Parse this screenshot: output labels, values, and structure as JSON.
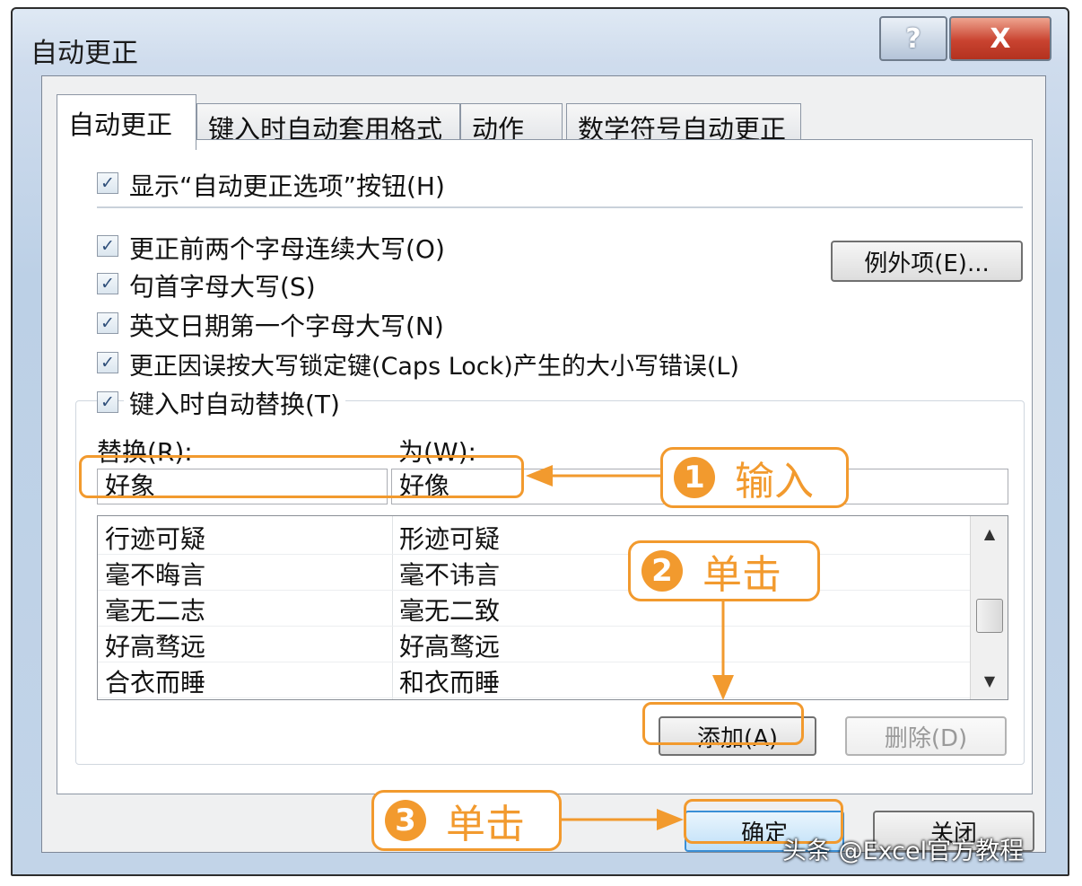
{
  "window": {
    "title": "自动更正",
    "help_label": "?",
    "close_label": "X"
  },
  "tabs": [
    {
      "label": "自动更正"
    },
    {
      "label": "键入时自动套用格式"
    },
    {
      "label": "动作"
    },
    {
      "label": "数学符号自动更正"
    }
  ],
  "options": {
    "show_buttons": "显示“自动更正选项”按钮(H)",
    "two_initials": "更正前两个字母连续大写(O)",
    "sentence_cap": "句首字母大写(S)",
    "day_names": "英文日期第一个字母大写(N)",
    "caps_lock": "更正因误按大写锁定键(Caps Lock)产生的大小写错误(L)",
    "replace_as_type": "键入时自动替换(T)",
    "check_mark": "✓"
  },
  "exceptions_button": "例外项(E)...",
  "replace": {
    "replace_label": "替换(R):",
    "with_label": "为(W):",
    "replace_value": "好象",
    "with_value": "好像"
  },
  "list": {
    "rows": [
      {
        "from": "行迹可疑",
        "to": "形迹可疑"
      },
      {
        "from": "毫不晦言",
        "to": "毫不讳言"
      },
      {
        "from": "毫无二志",
        "to": "毫无二致"
      },
      {
        "from": "好高骛远",
        "to": "好高鹜远"
      },
      {
        "from": "合衣而睡",
        "to": "和衣而睡"
      }
    ],
    "scroll_up": "▲",
    "scroll_down": "▼"
  },
  "buttons": {
    "add": "添加(A)",
    "delete": "删除(D)",
    "ok": "确定",
    "close": "关闭"
  },
  "callouts": [
    {
      "num": "1",
      "text": "输入"
    },
    {
      "num": "2",
      "text": "单击"
    },
    {
      "num": "3",
      "text": "单击"
    }
  ],
  "watermark": "头条 @Excel官方教程",
  "colors": {
    "accent": "#f29a2e",
    "title_bar": "#cfdced",
    "close_red": "#c94330"
  }
}
